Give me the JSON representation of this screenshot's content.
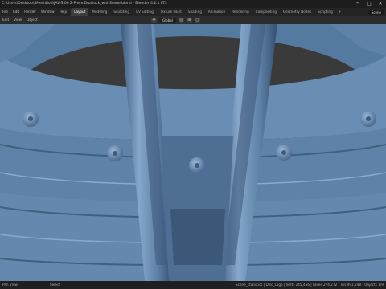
{
  "window": {
    "title": "C:\\Users\\Desktop\\3MeshRod\\JAVIS 06 2-Piece Duallock_withScene.blend - Blender 4.2.1 LTS",
    "minimize": "─",
    "maximize": "□",
    "close": "✕"
  },
  "menu": [
    "File",
    "Edit",
    "Render",
    "Window",
    "Help"
  ],
  "workspaces": [
    {
      "label": "Layout",
      "active": true
    },
    {
      "label": "Modeling",
      "active": false
    },
    {
      "label": "Sculpting",
      "active": false
    },
    {
      "label": "UV Editing",
      "active": false
    },
    {
      "label": "Texture Paint",
      "active": false
    },
    {
      "label": "Shading",
      "active": false
    },
    {
      "label": "Animation",
      "active": false
    },
    {
      "label": "Rendering",
      "active": false
    },
    {
      "label": "Compositing",
      "active": false
    },
    {
      "label": "Geometry Nodes",
      "active": false
    },
    {
      "label": "Scripting",
      "active": false
    }
  ],
  "workspace_add": "+",
  "scene": {
    "label": "Scene"
  },
  "view_header": {
    "mode": "Edit",
    "items": [
      "View",
      "Object"
    ],
    "orientation": "Global"
  },
  "status": {
    "left": "Pan View",
    "middle": "Select",
    "right": "Scene_statistics | Disc_Logo | Verts 245,456 | Faces 274,272 | Tris 491,248 | Objects 1/9"
  },
  "colors": {
    "mesh": "#5f82a8",
    "mesh_light": "#7e9fc4",
    "mesh_dark": "#3e5a7d",
    "background": "#3a3a3a"
  }
}
